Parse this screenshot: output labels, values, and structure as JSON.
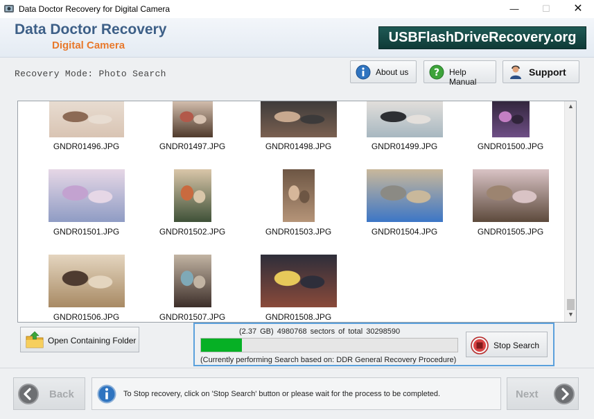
{
  "window": {
    "title": "Data Doctor Recovery for Digital Camera"
  },
  "banner": {
    "brand_line1": "Data Doctor Recovery",
    "brand_line2": "Digital Camera",
    "website": "USBFlashDriveRecovery.org"
  },
  "toolbar": {
    "mode_label": "Recovery Mode: Photo Search",
    "about_label": "About us",
    "help_label": "Help Manual",
    "support_label": "Support"
  },
  "thumbnails": [
    {
      "filename": "GNDR01496.JPG",
      "colors": [
        "#d9c4b3",
        "#8c6a55",
        "#e8ddd2"
      ]
    },
    {
      "filename": "GNDR01497.JPG",
      "colors": [
        "#4f3a2c",
        "#b2594a",
        "#d7c2b1"
      ]
    },
    {
      "filename": "GNDR01498.JPG",
      "colors": [
        "#7a6050",
        "#c8a98f",
        "#3c3a3a"
      ]
    },
    {
      "filename": "GNDR01499.JPG",
      "colors": [
        "#a7b7c0",
        "#2d2f33",
        "#e4e0dc"
      ]
    },
    {
      "filename": "GNDR01500.JPG",
      "colors": [
        "#6f4f86",
        "#c37fc4",
        "#30243a"
      ]
    },
    {
      "filename": "GNDR01501.JPG",
      "colors": [
        "#8f9cc4",
        "#c3a2d0",
        "#e6d7e6"
      ]
    },
    {
      "filename": "GNDR01502.JPG",
      "colors": [
        "#3f5138",
        "#c96a3f",
        "#d9c6a9"
      ]
    },
    {
      "filename": "GNDR01503.JPG",
      "colors": [
        "#b59478",
        "#d6b79a",
        "#6d5644"
      ]
    },
    {
      "filename": "GNDR01504.JPG",
      "colors": [
        "#3c76c6",
        "#8b8a84",
        "#c9b89b"
      ]
    },
    {
      "filename": "GNDR01505.JPG",
      "colors": [
        "#5d4a3c",
        "#9c8470",
        "#d9c3c5"
      ]
    },
    {
      "filename": "GNDR01506.JPG",
      "colors": [
        "#a88a64",
        "#4e3b30",
        "#e4d5bf"
      ]
    },
    {
      "filename": "GNDR01507.JPG",
      "colors": [
        "#3d2f2a",
        "#7fa9b7",
        "#c2b4a3"
      ]
    },
    {
      "filename": "GNDR01508.JPG",
      "colors": [
        "#8a4a3a",
        "#e7c95a",
        "#2e2e3a"
      ]
    }
  ],
  "actions": {
    "open_folder_label": "Open Containing Folder",
    "stop_label": "Stop Search"
  },
  "progress": {
    "stats_text": "(2.37 GB) 4980768   sectors  of  total 30298590",
    "value": 0.16,
    "procedure_text": "(Currently performing Search based on:  DDR General Recovery Procedure)"
  },
  "footer": {
    "back_label": "Back",
    "next_label": "Next",
    "info_text": "To Stop recovery, click on 'Stop Search' button or please wait for the process to be completed."
  }
}
